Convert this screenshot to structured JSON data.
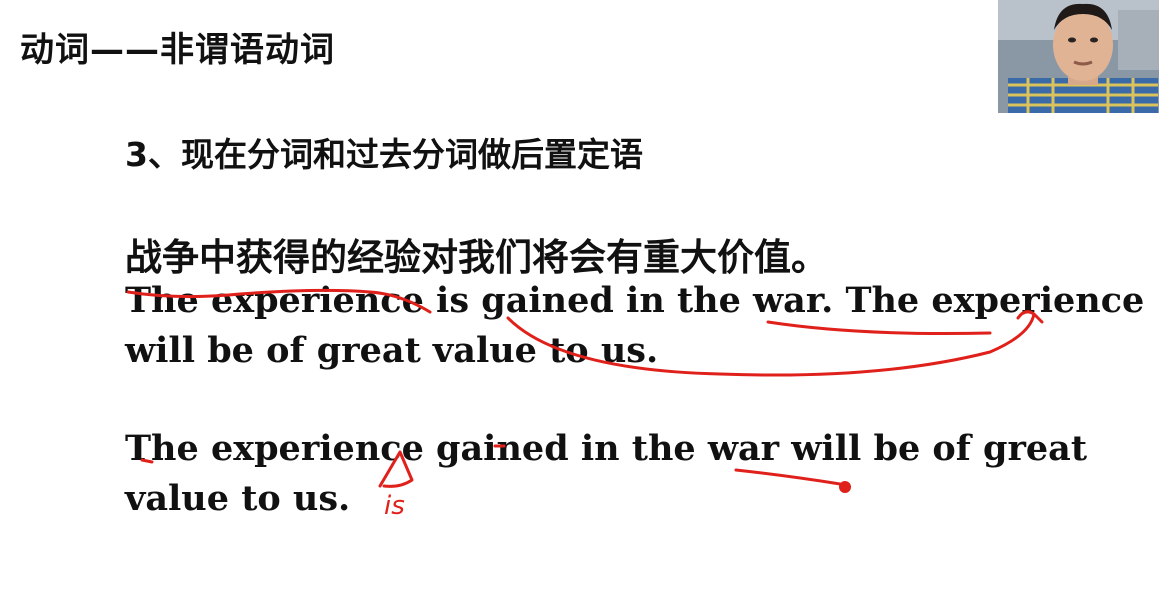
{
  "slide": {
    "title": "动词——非谓语动词",
    "subtitle": "3、现在分词和过去分词做后置定语",
    "chinese_sentence": "战争中获得的经验对我们将会有重大价值。",
    "original_line_1": "The experience is gained in the war. The experience",
    "original_line_2": "will be of great value to us.",
    "rewritten_line_1": "The experience gained in the war will be of great",
    "rewritten_line_2": "value to us."
  },
  "annotations": {
    "ink_color": "#e0201a",
    "handwritten_note": "is"
  },
  "webcam": {
    "icon": "presenter-video"
  }
}
